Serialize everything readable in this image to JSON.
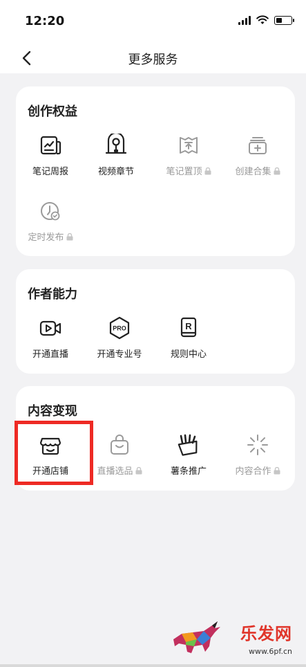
{
  "status_bar": {
    "time": "12:20"
  },
  "nav": {
    "title": "更多服务"
  },
  "sections": [
    {
      "title": "创作权益",
      "items": [
        {
          "label": "笔记周报",
          "icon": "weekly-report-icon",
          "locked": false
        },
        {
          "label": "视频章节",
          "icon": "video-chapter-icon",
          "locked": false
        },
        {
          "label": "笔记置顶",
          "icon": "pin-top-icon",
          "locked": true
        },
        {
          "label": "创建合集",
          "icon": "collection-add-icon",
          "locked": true
        },
        {
          "label": "定时发布",
          "icon": "scheduled-publish-icon",
          "locked": true
        }
      ]
    },
    {
      "title": "作者能力",
      "items": [
        {
          "label": "开通直播",
          "icon": "live-video-icon",
          "locked": false
        },
        {
          "label": "开通专业号",
          "icon": "pro-badge-icon",
          "locked": false
        },
        {
          "label": "规则中心",
          "icon": "rules-icon",
          "locked": false
        }
      ]
    },
    {
      "title": "内容变现",
      "items": [
        {
          "label": "开通店铺",
          "icon": "shop-icon",
          "locked": false
        },
        {
          "label": "直播选品",
          "icon": "shopping-bag-icon",
          "locked": true
        },
        {
          "label": "薯条推广",
          "icon": "fries-promo-icon",
          "locked": false
        },
        {
          "label": "内容合作",
          "icon": "sparkle-icon",
          "locked": true
        }
      ]
    }
  ],
  "pro_icon_text": "PRO",
  "rules_icon_text": "R",
  "watermark": {
    "text": "乐发网",
    "url": "www.6pf.cn"
  },
  "colors": {
    "highlight": "#ee2a24",
    "locked_text": "#9a9a9a",
    "background": "#f2f2f4"
  }
}
